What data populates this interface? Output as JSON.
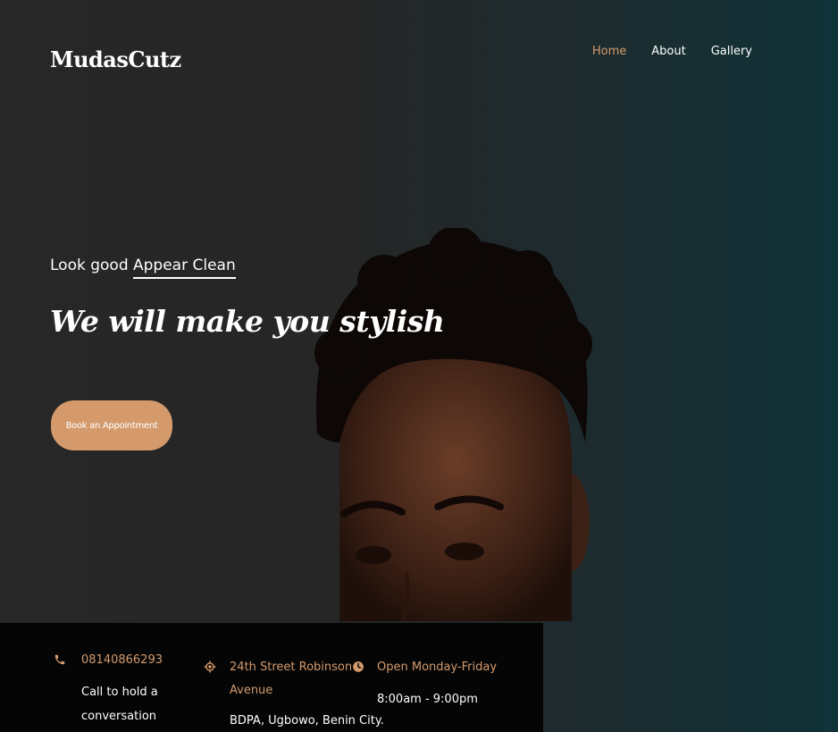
{
  "brand": {
    "logo": "MudasCutz"
  },
  "nav": {
    "items": [
      {
        "label": "Home",
        "active": true
      },
      {
        "label": "About",
        "active": false
      },
      {
        "label": "Gallery",
        "active": false
      }
    ]
  },
  "hero": {
    "tagline_plain": "Look good ",
    "tagline_highlight": "Appear Clean",
    "headline": "We will make you stylish",
    "cta_label": "Book an Appointment"
  },
  "info": {
    "phone": {
      "icon": "phone-icon",
      "number": "08140866293",
      "desc_line1": "Call to hold a",
      "desc_line2": "conversation"
    },
    "address": {
      "icon": "location-icon",
      "line1": "24th Street Robinson",
      "line2": "Avenue",
      "line3": "BDPA, Ugbowo, Benin City."
    },
    "hours": {
      "icon": "clock-icon",
      "days": "Open Monday-Friday",
      "time": "8:00am - 9:00pm"
    }
  },
  "colors": {
    "accent": "#d49a6c",
    "nav_active": "#d79b6d",
    "info_bg": "#050505"
  }
}
